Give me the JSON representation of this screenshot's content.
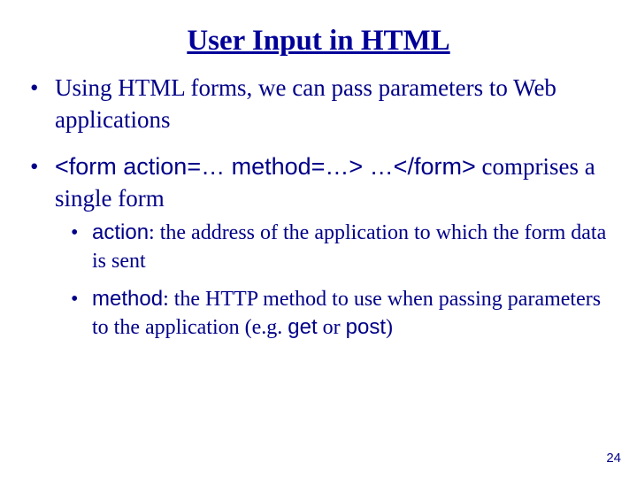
{
  "slide": {
    "title": "User Input in HTML",
    "bullets": {
      "b1": "Using HTML forms, we can pass parameters to Web applications",
      "b2_code": "<form action=… method=…> …</form>",
      "b2_tail": " comprises a single form",
      "sub1_label": "action",
      "sub1_text": ": the address of the application to which the form data is sent",
      "sub2_label": "method",
      "sub2_text_a": ": the HTTP method to use when passing parameters to the application (e.g. ",
      "sub2_get": "get",
      "sub2_or": " or ",
      "sub2_post": "post",
      "sub2_text_b": ")"
    },
    "page_number": "24"
  }
}
